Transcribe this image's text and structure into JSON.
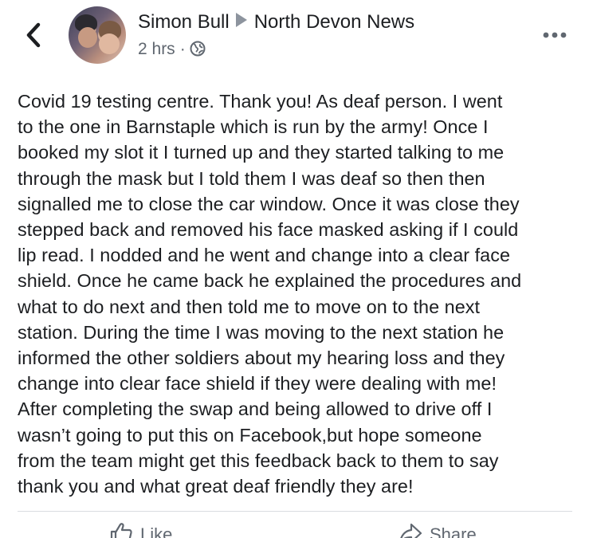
{
  "header": {
    "back_icon": "chevron-left-icon",
    "author": "Simon Bull",
    "target_page": "North Devon News",
    "timestamp": "2 hrs",
    "separator": "·",
    "privacy_icon": "globe-icon",
    "more_icon": "more-options-icon"
  },
  "post": {
    "text": "Covid 19 testing centre. Thank you! As deaf person. I went\nto the one in Barnstaple which is run by the army! Once I\nbooked my slot it I turned up and they started talking to me\nthrough the mask but I told them I was deaf so then then\nsignalled me to close the car window. Once it was close they\nstepped back and removed his face masked asking if I could\nlip read. I nodded and he went and change into a clear face\nshield. Once he came back he explained the procedures and\nwhat to do next and then told me to move on to the next\nstation. During the time I was moving to the next station he\ninformed the other soldiers about my hearing loss and they\nchange into clear face shield if they were dealing with me!\nAfter completing the swap and being allowed to drive off I\nwasn’t going to put this on Facebook,but hope someone\nfrom the team might get this feedback back to them to say\nthank you and what great deaf friendly they are!"
  },
  "actions": {
    "like_label": "Like",
    "like_icon": "thumbs-up-icon",
    "share_label": "Share",
    "share_icon": "share-icon"
  },
  "colors": {
    "text": "#1c1e21",
    "secondary": "#606770",
    "divider": "#dadde1",
    "arrow": "#8d949e"
  }
}
